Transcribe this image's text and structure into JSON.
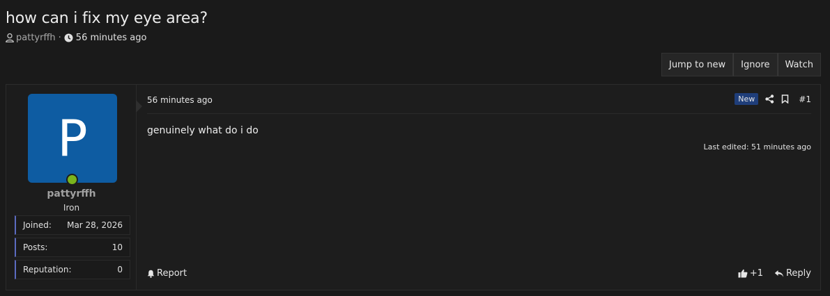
{
  "thread": {
    "title": "how can i fix my eye area?",
    "author": "pattyrffh",
    "separator": "·",
    "time_ago": "56 minutes ago"
  },
  "actions": {
    "jump_to_new": "Jump to new",
    "ignore": "Ignore",
    "watch": "Watch"
  },
  "post": {
    "avatar_letter": "P",
    "username": "pattyrffh",
    "user_title": "Iron",
    "stats": [
      {
        "label": "Joined:",
        "value": "Mar 28, 2026"
      },
      {
        "label": "Posts:",
        "value": "10"
      },
      {
        "label": "Reputation:",
        "value": "0"
      }
    ],
    "date": "56 minutes ago",
    "new_badge": "New",
    "number": "#1",
    "body": "genuinely what do i do",
    "last_edited": "Last edited: 51 minutes ago",
    "report_label": "Report",
    "reaction_count": "+1",
    "reply_label": "Reply"
  },
  "colors": {
    "background": "#1a1a1a",
    "avatar": "#0e5ca2",
    "online": "#7ab41d",
    "badge_new": "#1f3e7a",
    "stat_accent": "#5c6bc0"
  },
  "icons": {
    "user": "user-icon",
    "clock": "clock-icon",
    "share": "share-icon",
    "bookmark": "bookmark-icon",
    "report": "bell-icon",
    "like": "thumbs-up-icon",
    "reply": "reply-icon"
  }
}
